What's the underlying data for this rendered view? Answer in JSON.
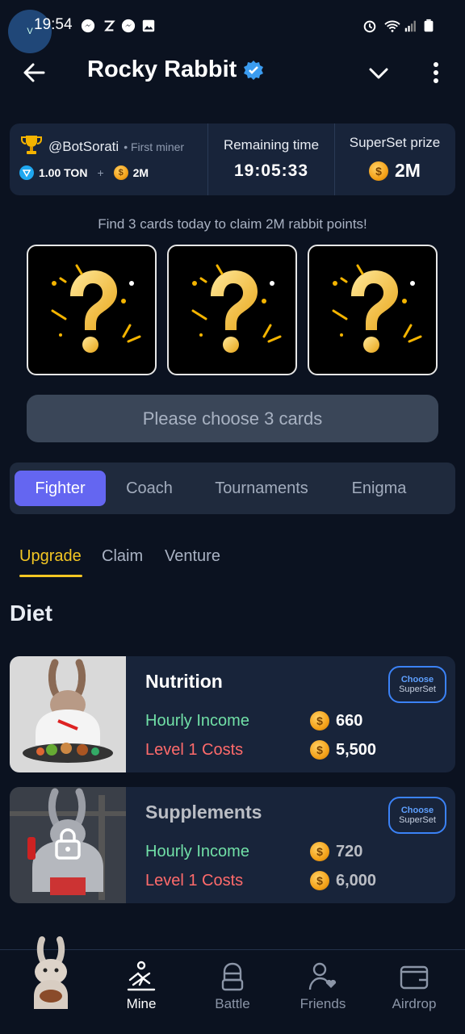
{
  "status_bar": {
    "time": "19:54",
    "watermark": "V"
  },
  "header": {
    "title": "Rocky Rabbit"
  },
  "info": {
    "handle": "@BotSorati",
    "handle_sub": "• First miner",
    "ton": "1.00 TON",
    "plus": "+",
    "bonus": "2M",
    "remaining_label": "Remaining time",
    "remaining_value": "19:05:33",
    "prize_label": "SuperSet prize",
    "prize_value": "2M"
  },
  "cards": {
    "instruction": "Find 3 cards today to claim 2M rabbit points!",
    "choose_button": "Please choose 3 cards"
  },
  "tabs": [
    {
      "label": "Fighter",
      "active": true
    },
    {
      "label": "Coach",
      "active": false
    },
    {
      "label": "Tournaments",
      "active": false
    },
    {
      "label": "Enigma",
      "active": false
    }
  ],
  "subtabs": [
    {
      "label": "Upgrade",
      "active": true
    },
    {
      "label": "Claim",
      "active": false
    },
    {
      "label": "Venture",
      "active": false
    }
  ],
  "section_title": "Diet",
  "upgrades": [
    {
      "name": "Nutrition",
      "income_label": "Hourly Income",
      "income_value": "660",
      "cost_label": "Level 1 Costs",
      "cost_value": "5,500",
      "choose_line1": "Choose",
      "choose_line2": "SuperSet",
      "locked": false
    },
    {
      "name": "Supplements",
      "income_label": "Hourly Income",
      "income_value": "720",
      "cost_label": "Level 1 Costs",
      "cost_value": "6,000",
      "choose_line1": "Choose",
      "choose_line2": "SuperSet",
      "locked": true
    }
  ],
  "bottom_nav": [
    {
      "label": "Mine",
      "icon": "mine-icon",
      "active": true
    },
    {
      "label": "Battle",
      "icon": "battle-icon",
      "active": false
    },
    {
      "label": "Friends",
      "icon": "friends-icon",
      "active": false
    },
    {
      "label": "Airdrop",
      "icon": "airdrop-icon",
      "active": false
    }
  ],
  "colors": {
    "background": "#0b1220",
    "panel": "#18243a",
    "accent_tab": "#6466f1",
    "accent_yellow": "#f3c623",
    "income_green": "#71e0a7",
    "cost_red": "#ff6b6b",
    "choose_blue": "#3b82f6"
  }
}
